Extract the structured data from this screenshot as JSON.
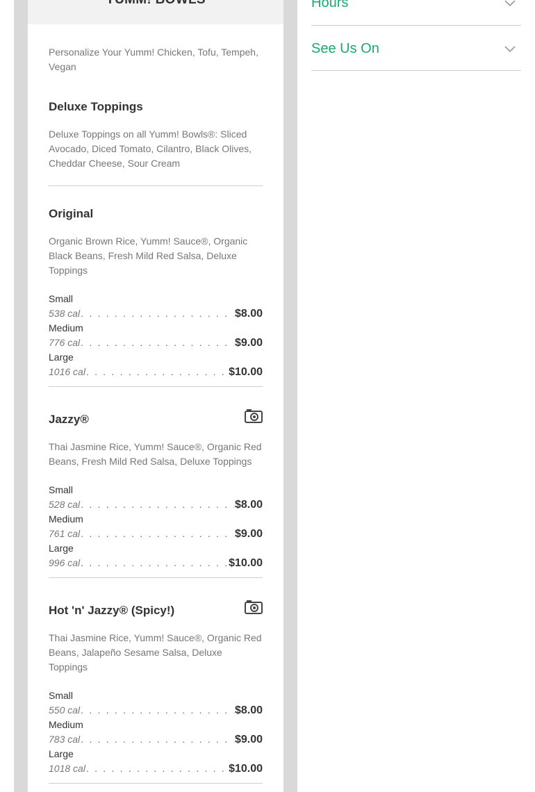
{
  "menu": {
    "title": "YUMM! BOWLS",
    "intro": "Personalize Your Yumm! Chicken, Tofu, Tempeh, Vegan",
    "sections": [
      {
        "title": "Deluxe Toppings",
        "description": "Deluxe Toppings on all Yumm! Bowls®: Sliced Avocado, Diced Tomato, Cilantro, Black Olives, Cheddar Cheese, Sour Cream"
      },
      {
        "title": "Original",
        "description": "Organic Brown Rice, Yumm! Sauce®, Organic Black Beans, Fresh Mild Red Salsa, Deluxe Toppings",
        "has_photo": false,
        "sizes": [
          {
            "name": "Small",
            "calories": "538 cal",
            "price": "$8.00"
          },
          {
            "name": "Medium",
            "calories": "776 cal",
            "price": "$9.00"
          },
          {
            "name": "Large",
            "calories": "1016 cal",
            "price": "$10.00"
          }
        ]
      },
      {
        "title": "Jazzy®",
        "description": "Thai Jasmine Rice, Yumm! Sauce®, Organic Red Beans, Fresh Mild Red Salsa, Deluxe Toppings",
        "has_photo": true,
        "sizes": [
          {
            "name": "Small",
            "calories": "528 cal",
            "price": "$8.00"
          },
          {
            "name": "Medium",
            "calories": "761 cal",
            "price": "$9.00"
          },
          {
            "name": "Large",
            "calories": "996 cal",
            "price": "$10.00"
          }
        ]
      },
      {
        "title": "Hot 'n' Jazzy® (Spicy!)",
        "description": "Thai Jasmine Rice, Yumm! Sauce®, Organic Red Beans, Jalapeño Sesame Salsa, Deluxe Toppings",
        "has_photo": true,
        "sizes": [
          {
            "name": "Small",
            "calories": "550 cal",
            "price": "$8.00"
          },
          {
            "name": "Medium",
            "calories": "783 cal",
            "price": "$9.00"
          },
          {
            "name": "Large",
            "calories": "1018 cal",
            "price": "$10.00"
          }
        ]
      }
    ]
  },
  "sidebar": {
    "accordion": [
      {
        "label": "Hours",
        "icon": "chevron-down-icon"
      },
      {
        "label": "See Us On",
        "icon": "chevron-down-icon"
      }
    ]
  },
  "colors": {
    "accent": "#1aaa6b",
    "heading": "#333333",
    "muted": "#777777",
    "column_border": "#d9d9d9"
  }
}
